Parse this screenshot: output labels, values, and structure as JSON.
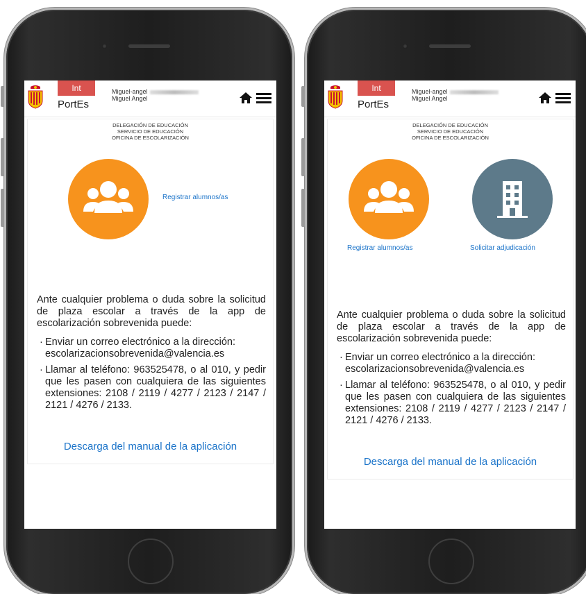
{
  "header": {
    "int_label": "Int",
    "app_name": "PortEs",
    "user_line1": "Miguel-angel",
    "user_line2": "Miguel Angel"
  },
  "department": {
    "line1": "DELEGACIÓN DE EDUCACIÓN",
    "line2": "SERVICIO DE EDUCACIÓN",
    "line3": "OFICINA DE ESCOLARIZACIÓN"
  },
  "actions": {
    "register_label": "Registrar alumnos/as",
    "request_label": "Solicitar adjudicación"
  },
  "info": {
    "intro": "Ante cualquier problema o duda sobre la solicitud de plaza escolar a través de la app de escolarización sobrevenida puede:",
    "email_item": "Enviar un correo electrónico a la dirección:",
    "email": "escolarizacionsobrevenida@valencia.es",
    "phone_item": "Llamar al teléfono: 963525478, o al 010, y pedir que les pasen con cualquiera de las siguientes extensiones: 2108 / 2119 / 4277 / 2123 / 2147 / 2121 / 4276 / 2133."
  },
  "download_link": "Descarga del manual de la aplicación",
  "icons": {
    "logo": "city-crest-icon",
    "home": "home-icon",
    "menu": "hamburger-menu-icon",
    "students": "group-users-icon",
    "building": "building-icon"
  },
  "colors": {
    "badge": "#d9534f",
    "orange": "#f7931d",
    "slate": "#5d7a8a",
    "link": "#1a73c9"
  }
}
